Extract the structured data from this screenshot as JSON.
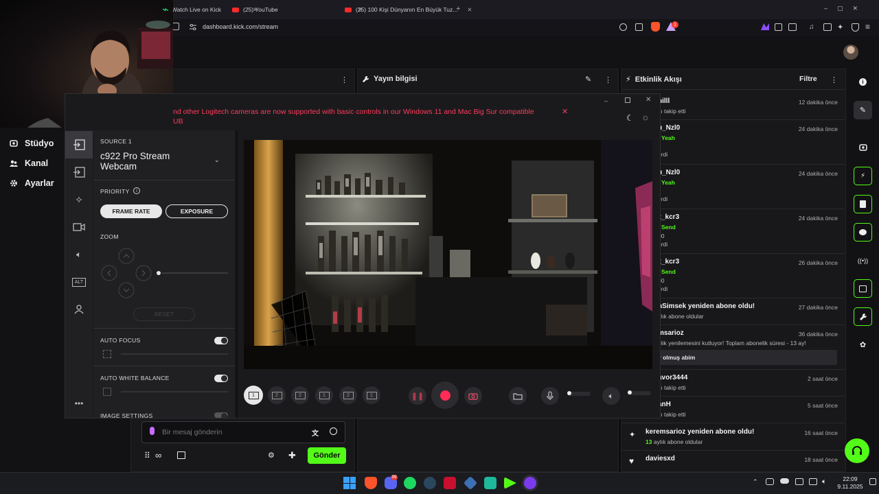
{
  "browser": {
    "tabs": [
      {
        "label": "Watch Live on Kick"
      },
      {
        "label": "(25) YouTube"
      },
      {
        "label": "(25) 100 Kişi Dünyanın En Büyük Tuz..."
      }
    ],
    "url": "dashboard.kick.com/stream",
    "notification_count": "1"
  },
  "nav": {
    "items": [
      {
        "label": "Stüdyo",
        "icon": "studio-icon"
      },
      {
        "label": "Kanal",
        "icon": "users-icon"
      },
      {
        "label": "Ayarlar",
        "icon": "gear-icon"
      }
    ]
  },
  "panels": {
    "stream_info_title": "Yayın bilgisi",
    "activity_title": "Etkinlik Akışı",
    "filter_label": "Filtre"
  },
  "logitech": {
    "banner": "nd other Logitech cameras are now supported with basic controls in our Windows 11 and Mac Big Sur compatible",
    "banner_line2": "UB",
    "source_label": "SOURCE 1",
    "camera_name": "c922 Pro Stream Webcam",
    "priority_label": "PRIORITY",
    "frame_rate_label": "FRAME RATE",
    "exposure_label": "EXPOSURE",
    "zoom_label": "ZOOM",
    "reset_label": "RESET",
    "auto_focus_label": "AUTO FOCUS",
    "auto_white_balance_label": "AUTO WHITE BALANCE",
    "image_settings_label": "IMAGE SETTINGS",
    "layouts": [
      "1",
      "2",
      "2",
      "1",
      "2",
      "1"
    ]
  },
  "feed": {
    "items": [
      {
        "name": "hilll",
        "time": "12 dakika önce",
        "lines": [
          "ılı takip etti"
        ]
      },
      {
        "name": "u_Nzl0",
        "time": "24 dakika önce",
        "highlight": "Yeah",
        "lines": [
          "erdi"
        ]
      },
      {
        "name": "u_Nzl0",
        "time": "24 dakika önce",
        "highlight": "Yeah",
        "lines": [
          "erdi"
        ]
      },
      {
        "name": "z_kcr3",
        "time": "24 dakika önce",
        "highlight": "Send",
        "lines": [
          "00",
          "erdi"
        ]
      },
      {
        "name": "z_kcr3",
        "time": "26 dakika önce",
        "highlight": "Send",
        "lines": [
          "00",
          "erdi"
        ]
      },
      {
        "name": "nSimsek yeniden abone oldu!",
        "time": "27 dakika önce",
        "lines": [
          "ylık abone oldular"
        ]
      },
      {
        "name": "msarioz",
        "time": "36 dakika önce",
        "lines": [
          "elik yenilemesini kutluyor! Toplam abonelik süresi - 13 ay!"
        ],
        "message": "y olmuş abim"
      },
      {
        "name": "avor3444",
        "time": "2 saat önce",
        "lines": [
          "ılı takip etti"
        ]
      },
      {
        "name": "anH",
        "time": "5 saat önce",
        "lines": [
          "ılı takip etti"
        ]
      },
      {
        "name": "keremsarioz yeniden abone oldu!",
        "time": "16 saat önce",
        "lines": [
          "aylık abone oldular"
        ],
        "count": "13"
      },
      {
        "name": "daviesxd",
        "time": "18 saat önce",
        "lines": []
      }
    ]
  },
  "chat": {
    "placeholder": "Bir mesaj gönderin",
    "send_label": "Gönder"
  },
  "taskbar": {
    "time": "22:09",
    "date": "9.11.2025",
    "badge": "99"
  },
  "colors": {
    "accent": "#53fc18",
    "banner_red": "#ff3b5c",
    "record_red": "#ff2d55"
  }
}
